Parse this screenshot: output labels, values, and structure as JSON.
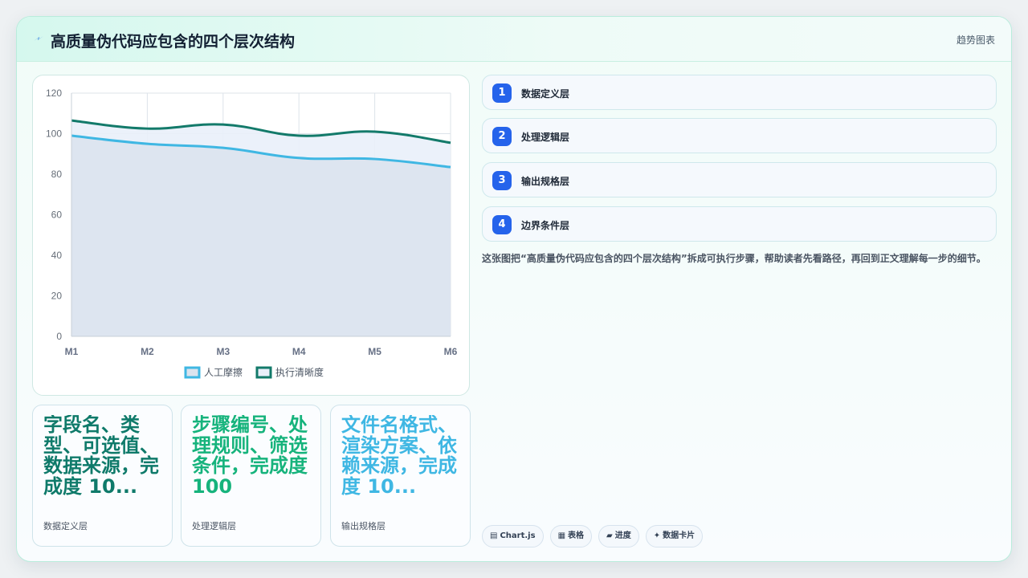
{
  "header": {
    "icon": "lightning-icon",
    "title": "高质量伪代码应包含的四个层次结构",
    "tag": "趋势图表"
  },
  "chart_data": {
    "type": "line",
    "categories": [
      "M1",
      "M2",
      "M3",
      "M4",
      "M5",
      "M6"
    ],
    "series": [
      {
        "name": "人工摩擦",
        "values": [
          99,
          95,
          93,
          88,
          87.5,
          83.5
        ],
        "color": "#3fb7e3",
        "fill": "#dbe3ee"
      },
      {
        "name": "执行清晰度",
        "values": [
          106.5,
          102.5,
          104.5,
          99,
          101,
          95.5
        ],
        "color": "#137a6a",
        "fill": "#e9effa"
      }
    ],
    "ylim": [
      0,
      120
    ],
    "yticks": [
      0,
      20,
      40,
      60,
      80,
      100,
      120
    ],
    "grid": true,
    "legend": "bottom"
  },
  "stats": [
    {
      "value": "字段名、类型、可选值、数据来源，完成度 10...",
      "label": "数据定义层",
      "color": "#0f7a6a"
    },
    {
      "value": "步骤编号、处理规则、筛选条件，完成度 100",
      "label": "处理逻辑层",
      "color": "#16b37c"
    },
    {
      "value": "文件名格式、渲染方案、依赖来源，完成度 10...",
      "label": "输出规格层",
      "color": "#3fb7e3"
    }
  ],
  "steps": [
    {
      "num": "1",
      "label": "数据定义层"
    },
    {
      "num": "2",
      "label": "处理逻辑层"
    },
    {
      "num": "3",
      "label": "输出规格层"
    },
    {
      "num": "4",
      "label": "边界条件层"
    }
  ],
  "description": "这张图把“高质量伪代码应包含的四个层次结构”拆成可执行步骤，帮助读者先看路径，再回到正文理解每一步的细节。",
  "tags": [
    {
      "icon": "chart-icon",
      "glyph": "▤",
      "label": "Chart.js"
    },
    {
      "icon": "table-icon",
      "glyph": "▦",
      "label": "表格"
    },
    {
      "icon": "progress-icon",
      "glyph": "▰",
      "label": "进度"
    },
    {
      "icon": "sparkle-icon",
      "glyph": "✦",
      "label": "数据卡片"
    }
  ]
}
